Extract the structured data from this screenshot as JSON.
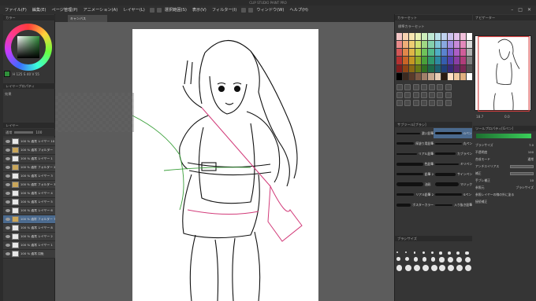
{
  "app": {
    "title": "CLIP STUDIO PAINT PRO"
  },
  "menu": {
    "items": [
      "ファイル(F)",
      "編集(E)",
      "ページ管理(P)",
      "アニメーション(A)",
      "レイヤー(L)",
      "選択範囲(S)",
      "表示(V)",
      "フィルター(I)",
      "ウィンドウ(W)",
      "ヘルプ(H)"
    ]
  },
  "canvas_tab": {
    "label": "キャンバス"
  },
  "color_panel": {
    "header": "カラー",
    "values": "H 125 S 40 V 55"
  },
  "layer_property": {
    "header": "レイヤープロパティ",
    "effect_label": "効果"
  },
  "layers": {
    "header": "レイヤー",
    "blend_mode": "通常",
    "opacity": "100",
    "rows": [
      {
        "name": "100 % 通常\nレイヤー 10"
      },
      {
        "name": "100 % 通常\nフォルダー"
      },
      {
        "name": "100 % 通常\nレイヤー 1"
      },
      {
        "name": "100 % 通常\nフォルダー 2"
      },
      {
        "name": "100 % 通常\nレイヤー 3"
      },
      {
        "name": "100 % 通常\nフォルダー 3"
      },
      {
        "name": "100 % 通常\nレイヤー 4"
      },
      {
        "name": "100 % 通常\nレイヤー 5"
      },
      {
        "name": "100 % 通常\nレイヤー 6"
      },
      {
        "name": "100 % 通常\nフォルダー 7"
      },
      {
        "name": "100 % 通常\nレイヤー 8"
      },
      {
        "name": "100 % 通常\nレイヤー 2"
      },
      {
        "name": "100 % 通常\nレイヤー 1"
      },
      {
        "name": "100 % 通常\n用紙"
      }
    ],
    "selected_index": 9
  },
  "color_set": {
    "header": "カラーセット",
    "name": "標準カラーセット",
    "swatches": [
      "#f4c6c6",
      "#f7d2b0",
      "#f7e6b0",
      "#eaf2b4",
      "#cdeebb",
      "#bfe8d4",
      "#bde2ea",
      "#c0d2ef",
      "#ccc2ee",
      "#e3c2ec",
      "#f1c1dc",
      "#ffffff",
      "#e98a8a",
      "#efae78",
      "#eecd72",
      "#d2e273",
      "#9fd883",
      "#84d1ad",
      "#80c6d8",
      "#89a8e0",
      "#a08ce0",
      "#c88ad9",
      "#e389bb",
      "#d9d9d9",
      "#d45656",
      "#e2874a",
      "#dfb646",
      "#b7cf46",
      "#6fc25a",
      "#52b98b",
      "#4eaec4",
      "#5a83cf",
      "#7762cf",
      "#ac5ec6",
      "#d05d9a",
      "#b0b0b0",
      "#b53131",
      "#c96427",
      "#c49623",
      "#95ad27",
      "#4aa03a",
      "#30986c",
      "#2d8ba2",
      "#355eaf",
      "#5341ae",
      "#8a3ea5",
      "#b03d7a",
      "#808080",
      "#7e1e1e",
      "#8e4416",
      "#8a6814",
      "#687916",
      "#307022",
      "#1e6a4a",
      "#1c6170",
      "#20407a",
      "#382a79",
      "#5f2873",
      "#7a2854",
      "#505050",
      "#000000",
      "#3b2a20",
      "#5a3b2a",
      "#7d5a44",
      "#a0806a",
      "#c7a88f",
      "#e8cdb5",
      "#2a1a10",
      "#ffdfc4",
      "#f0c8a0",
      "#e0b080",
      "#ffffff"
    ]
  },
  "sub_tool": {
    "header": "サブツール[ブラシ]",
    "col1": [
      "濃い鉛筆",
      "厚塗り用鉛筆",
      "リアル鉛筆",
      "色鉛筆",
      "鉛筆 2",
      "油彩",
      "リアル鉛筆 2",
      "ポスターカラー"
    ],
    "col2": [
      "Gペン",
      "丸ペン",
      "カブラペン",
      "ミリペン",
      "サインペン",
      "マジック",
      "Sペン",
      "入り抜き鉛筆"
    ]
  },
  "tool_property": {
    "header": "ツールプロパティ[Gペン]",
    "tool_name": "Gペン",
    "props": [
      {
        "label": "ブラシサイズ",
        "value": "7.0"
      },
      {
        "label": "不透明度",
        "value": "100"
      },
      {
        "label": "合成モード",
        "value": "通常"
      },
      {
        "label": "アンチエイリアス",
        "value": ""
      },
      {
        "label": "補正",
        "value": ""
      },
      {
        "label": "手ブレ補正",
        "value": "10"
      },
      {
        "label": "参照元",
        "value": "ブラシサイズ"
      }
    ],
    "checkbox_label": "参照レイヤーの線の外に塗る",
    "checkbox2_label": "接続補正"
  },
  "brush_size": {
    "header": "ブラシサイズ",
    "values": [
      "0.7",
      "1",
      "1.5",
      "2",
      "2.5",
      "3",
      "4",
      "5",
      "6",
      "7",
      "8",
      "10",
      "12",
      "15",
      "17",
      "20",
      "25",
      "30",
      "40",
      "50",
      "60",
      "70",
      "80",
      "100",
      "120",
      "150",
      "170"
    ]
  },
  "navigator": {
    "header": "ナビゲーター",
    "zoom": "18.7",
    "angle": "0.0"
  }
}
